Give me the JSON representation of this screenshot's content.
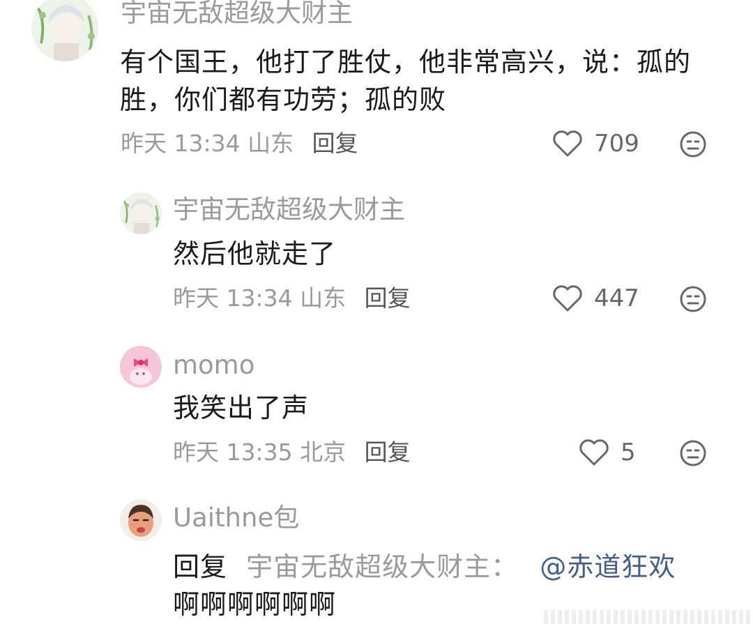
{
  "comments": [
    {
      "username": "宇宙无敌超级大财主",
      "content": "有个国王，他打了胜仗，他非常高兴，说：孤的胜，你们都有功劳；孤的败",
      "time": "昨天 13:34",
      "location": "山东",
      "reply_label": "回复",
      "likes": "709",
      "avatar_icon": "anime-boy-avatar"
    },
    {
      "username": "宇宙无敌超级大财主",
      "content": "然后他就走了",
      "time": "昨天 13:34",
      "location": "山东",
      "reply_label": "回复",
      "likes": "447",
      "avatar_icon": "anime-boy-avatar"
    },
    {
      "username": "momo",
      "content": "我笑出了声",
      "time": "昨天 13:35",
      "location": "北京",
      "reply_label": "回复",
      "likes": "5",
      "avatar_icon": "pink-bear-avatar"
    },
    {
      "username": "Uaithne包",
      "reply_prefix": "回复",
      "reply_target": "宇宙无敌超级大财主：",
      "mention": "@赤道狂欢",
      "content": "啊啊啊啊啊啊",
      "avatar_icon": "cartoon-man-avatar"
    }
  ],
  "icons": {
    "like": "heart-outline-icon",
    "reaction": "neutral-face-icon"
  },
  "colors": {
    "muted_text": "#9a9a9a",
    "mention": "#3f5f94",
    "body_text": "#1a1a1a"
  }
}
